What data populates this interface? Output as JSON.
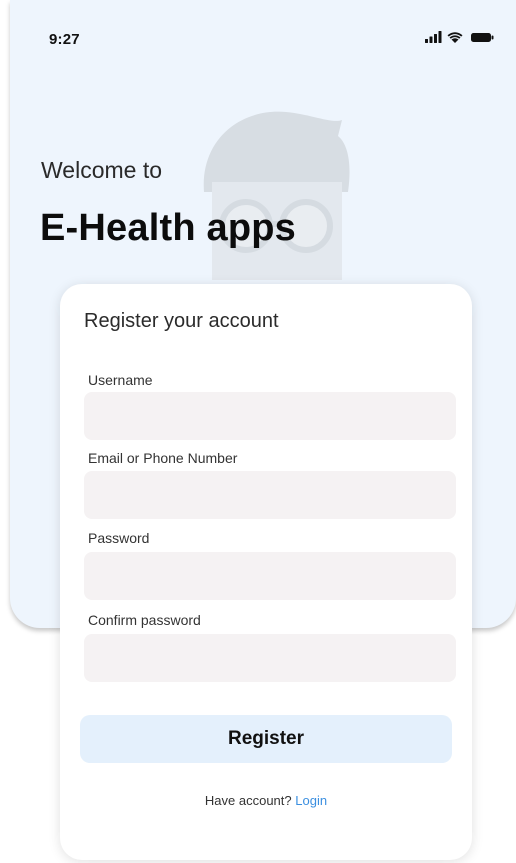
{
  "status_bar": {
    "time": "9:27",
    "icons": [
      "signal-icon",
      "wifi-icon",
      "battery-icon"
    ]
  },
  "hero": {
    "welcome": "Welcome to",
    "app_name": "E-Health apps",
    "mascot": "doctor-avatar-icon"
  },
  "form": {
    "title": "Register your account",
    "fields": [
      {
        "label": "Username",
        "value": "",
        "placeholder": ""
      },
      {
        "label": "Email or Phone Number",
        "value": "",
        "placeholder": ""
      },
      {
        "label": "Password",
        "value": "",
        "placeholder": ""
      },
      {
        "label": "Confirm password",
        "value": "",
        "placeholder": ""
      }
    ],
    "submit_label": "Register",
    "login_prompt": "Have account?",
    "login_link": "Login"
  },
  "colors": {
    "hero_bg": "#eef5fd",
    "input_bg": "#f5f2f3",
    "button_bg": "#e4f0fc",
    "link": "#3b8fe0"
  }
}
